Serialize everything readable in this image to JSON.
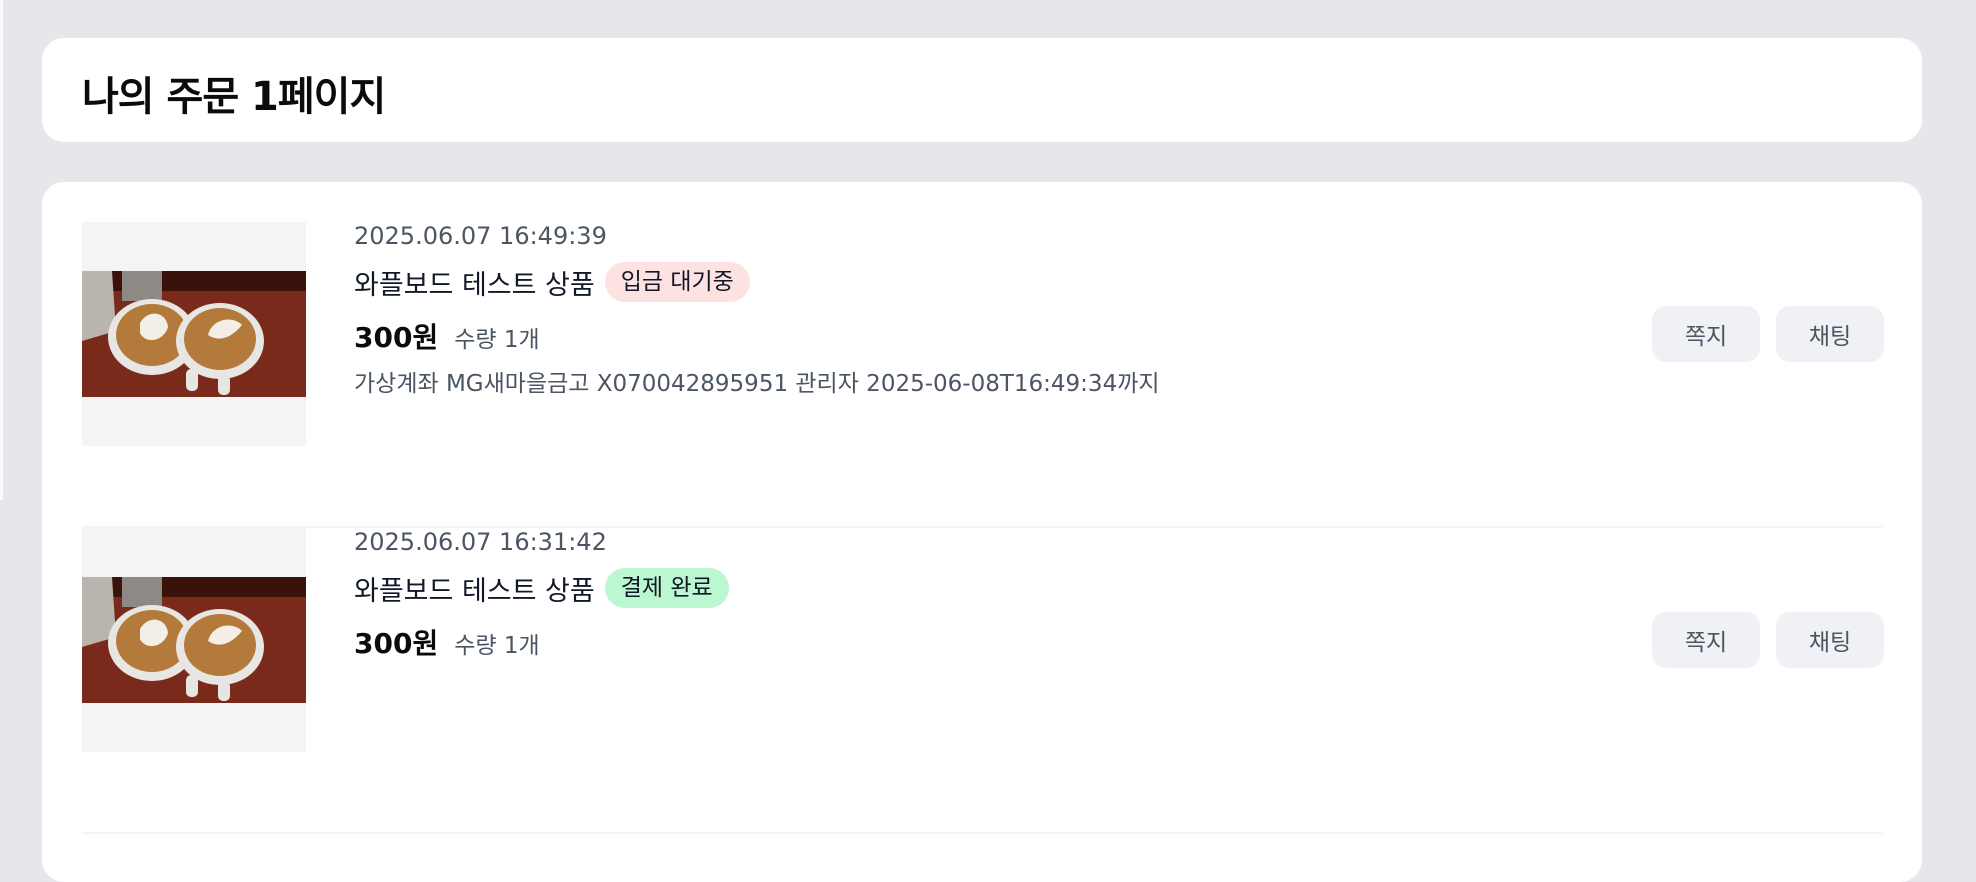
{
  "page": {
    "title": "나의 주문 1페이지"
  },
  "orders": [
    {
      "datetime": "2025.06.07 16:49:39",
      "product": "와플보드 테스트 상품",
      "status": "입금 대기중",
      "status_color": "#fde2e2",
      "price": "300원",
      "quantity": "수량 1개",
      "account_info": "가상계좌 MG새마을금고 X070042895951 관리자 2025-06-08T16:49:34까지",
      "image": "latte-art-coffee-cups",
      "buttons": {
        "note": "쪽지",
        "chat": "채팅"
      }
    },
    {
      "datetime": "2025.06.07 16:31:42",
      "product": "와플보드 테스트 상품",
      "status": "결제 완료",
      "status_color": "#bbf7d0",
      "price": "300원",
      "quantity": "수량 1개",
      "image": "latte-art-coffee-cups",
      "buttons": {
        "note": "쪽지",
        "chat": "채팅"
      }
    }
  ]
}
